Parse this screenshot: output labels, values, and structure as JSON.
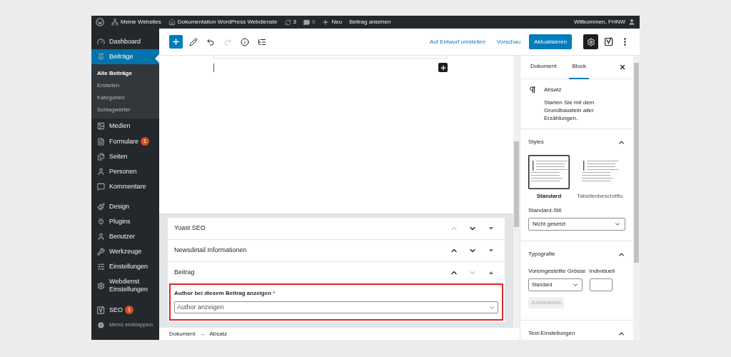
{
  "admin_bar": {
    "site": "Meine Websites",
    "page": "Dokumentation WordPress Webdienste",
    "updates": "3",
    "comments": "0",
    "new": "Neu",
    "view": "Beitrag ansehen",
    "greeting": "Willkommen, FHNW"
  },
  "menu": [
    {
      "kind": "item",
      "label": "Dashboard",
      "selected": false
    },
    {
      "kind": "item",
      "label": "Beiträge",
      "selected": true,
      "children": [
        {
          "label": "Alle Beiträge",
          "selected": true
        },
        {
          "label": "Erstellen",
          "selected": false
        },
        {
          "label": "Kategorien",
          "selected": false
        },
        {
          "label": "Schlagwörter",
          "selected": false
        }
      ]
    },
    {
      "kind": "item",
      "label": "Medien",
      "selected": false
    },
    {
      "kind": "item",
      "label": "Formulare",
      "badge": "1",
      "selected": false
    },
    {
      "kind": "item",
      "label": "Seiten",
      "selected": false
    },
    {
      "kind": "item",
      "label": "Personen",
      "selected": false
    },
    {
      "kind": "item",
      "label": "Kommentare",
      "selected": false
    },
    {
      "kind": "separator"
    },
    {
      "kind": "item",
      "label": "Design",
      "selected": false
    },
    {
      "kind": "item",
      "label": "Plugins",
      "selected": false
    },
    {
      "kind": "item",
      "label": "Benutzer",
      "selected": false
    },
    {
      "kind": "item",
      "label": "Werkzeuge",
      "selected": false
    },
    {
      "kind": "item",
      "label": "Einstellungen",
      "selected": false
    },
    {
      "kind": "item",
      "label": "Webdienst Einstellungen",
      "selected": false
    },
    {
      "kind": "separator"
    },
    {
      "kind": "item",
      "label": "SEO",
      "badge": "1",
      "selected": false
    },
    {
      "kind": "collapse",
      "label": "Menü einklappen"
    }
  ],
  "toolbar": {
    "switch_draft": "Auf Entwurf umstellen",
    "preview": "Vorschau",
    "update": "Aktualisieren"
  },
  "meta_boxes": [
    {
      "title": "Yoast SEO",
      "up_disabled": true,
      "down_disabled": false,
      "expanded": false
    },
    {
      "title": "Newsdetail Informationen",
      "up_disabled": false,
      "down_disabled": false,
      "expanded": false
    },
    {
      "title": "Beitrag",
      "up_disabled": false,
      "down_disabled": true,
      "expanded": true,
      "field": {
        "label": "Author bei diesem Beitrag anzeigen",
        "required": "*",
        "value": "Author anzeigen",
        "highlighted": true
      }
    }
  ],
  "breadcrumb": {
    "items": [
      "Dokument",
      "Absatz"
    ],
    "separator": "→"
  },
  "settings": {
    "tabs": [
      {
        "label": "Dokument",
        "selected": false
      },
      {
        "label": "Block",
        "selected": true
      }
    ],
    "block": {
      "name": "Absatz",
      "description": "Starten Sie mit dem Grundbaustein aller Erzählungen."
    },
    "styles": {
      "title": "Styles",
      "expanded": true,
      "options": [
        {
          "label": "Standard",
          "selected": true
        },
        {
          "label": "Tabellenbeschriftu",
          "selected": false
        }
      ],
      "default_label": "Standard-Stil",
      "default_value": "Nicht gesetzt"
    },
    "typography": {
      "title": "Typografie",
      "expanded": true,
      "preset_label": "Voreingestellte Grösse",
      "preset_value": "Standard",
      "custom_label": "Individuell",
      "reset": "Zurücksetzen",
      "reset_disabled": true
    },
    "text_settings": {
      "title": "Text-Einstellungen",
      "expanded": true
    }
  }
}
